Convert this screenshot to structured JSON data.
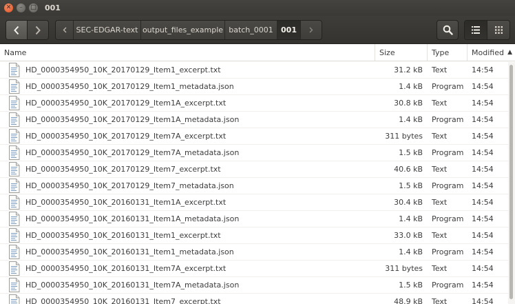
{
  "window": {
    "title": "001"
  },
  "toolbar": {
    "back_icon": "chevron-left-icon",
    "forward_icon": "chevron-right-icon",
    "path": [
      {
        "label": "SEC-EDGAR-text",
        "current": false
      },
      {
        "label": "output_files_example",
        "current": false
      },
      {
        "label": "batch_0001",
        "current": false
      },
      {
        "label": "001",
        "current": true
      }
    ],
    "search_icon": "search-icon",
    "list_view_icon": "list-view-icon",
    "grid_view_icon": "grid-view-icon"
  },
  "columns": {
    "name": "Name",
    "size": "Size",
    "type": "Type",
    "modified": "Modified",
    "sort": "ascending"
  },
  "files": [
    {
      "name": "HD_0000354950_10K_20170129_Item1_excerpt.txt",
      "size": "31.2 kB",
      "type": "Text",
      "modified": "14:54"
    },
    {
      "name": "HD_0000354950_10K_20170129_Item1_metadata.json",
      "size": "1.4 kB",
      "type": "Program",
      "modified": "14:54"
    },
    {
      "name": "HD_0000354950_10K_20170129_Item1A_excerpt.txt",
      "size": "30.8 kB",
      "type": "Text",
      "modified": "14:54"
    },
    {
      "name": "HD_0000354950_10K_20170129_Item1A_metadata.json",
      "size": "1.4 kB",
      "type": "Program",
      "modified": "14:54"
    },
    {
      "name": "HD_0000354950_10K_20170129_Item7A_excerpt.txt",
      "size": "311 bytes",
      "type": "Text",
      "modified": "14:54"
    },
    {
      "name": "HD_0000354950_10K_20170129_Item7A_metadata.json",
      "size": "1.5 kB",
      "type": "Program",
      "modified": "14:54"
    },
    {
      "name": "HD_0000354950_10K_20170129_Item7_excerpt.txt",
      "size": "40.6 kB",
      "type": "Text",
      "modified": "14:54"
    },
    {
      "name": "HD_0000354950_10K_20170129_Item7_metadata.json",
      "size": "1.5 kB",
      "type": "Program",
      "modified": "14:54"
    },
    {
      "name": "HD_0000354950_10K_20160131_Item1A_excerpt.txt",
      "size": "30.4 kB",
      "type": "Text",
      "modified": "14:54"
    },
    {
      "name": "HD_0000354950_10K_20160131_Item1A_metadata.json",
      "size": "1.4 kB",
      "type": "Program",
      "modified": "14:54"
    },
    {
      "name": "HD_0000354950_10K_20160131_Item1_excerpt.txt",
      "size": "33.0 kB",
      "type": "Text",
      "modified": "14:54"
    },
    {
      "name": "HD_0000354950_10K_20160131_Item1_metadata.json",
      "size": "1.4 kB",
      "type": "Program",
      "modified": "14:54"
    },
    {
      "name": "HD_0000354950_10K_20160131_Item7A_excerpt.txt",
      "size": "311 bytes",
      "type": "Text",
      "modified": "14:54"
    },
    {
      "name": "HD_0000354950_10K_20160131_Item7A_metadata.json",
      "size": "1.5 kB",
      "type": "Program",
      "modified": "14:54"
    },
    {
      "name": "HD_0000354950_10K_20160131_Item7_excerpt.txt",
      "size": "48.9 kB",
      "type": "Text",
      "modified": "14:54"
    }
  ]
}
